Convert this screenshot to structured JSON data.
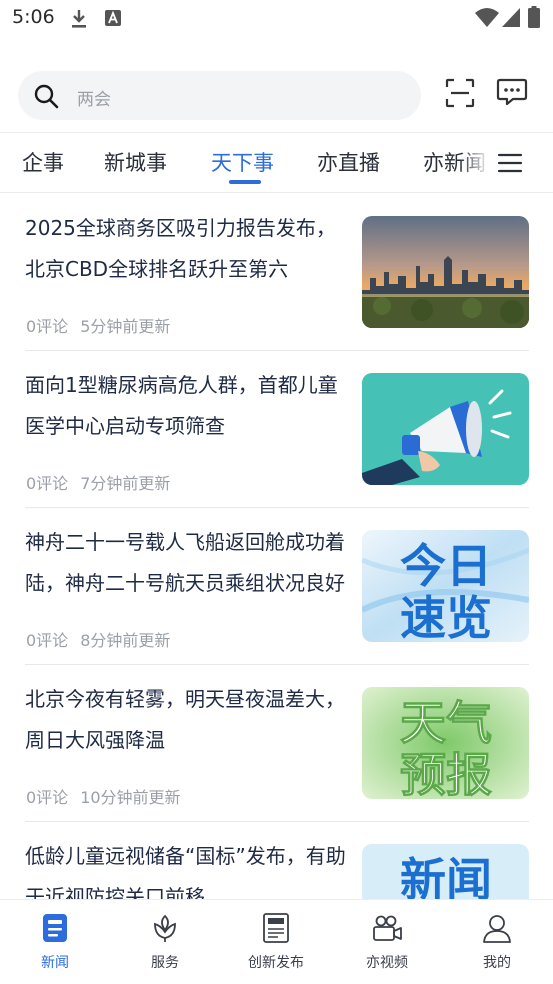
{
  "status_bar": {
    "time": "5:06"
  },
  "search": {
    "placeholder": "两会"
  },
  "tabs": [
    {
      "label": "企事"
    },
    {
      "label": "新城事"
    },
    {
      "label": "天下事",
      "active": true
    },
    {
      "label": "亦直播"
    },
    {
      "label": "亦新闻"
    }
  ],
  "feed": [
    {
      "title": "2025全球商务区吸引力报告发布，北京CBD全球排名跃升至第六",
      "comments": "0评论",
      "time": "5分钟前更新",
      "thumb": "city-skyline"
    },
    {
      "title": "面向1型糖尿病高危人群，首都儿童医学中心启动专项筛查",
      "comments": "0评论",
      "time": "7分钟前更新",
      "thumb": "megaphone"
    },
    {
      "title": "神舟二十一号载人飞船返回舱成功着陆，神舟二十号航天员乘组状况良好",
      "comments": "0评论",
      "time": "8分钟前更新",
      "thumb": "today-overview",
      "thumb_text": "今日速览"
    },
    {
      "title": "北京今夜有轻雾，明天昼夜温差大，周日大风强降温",
      "comments": "0评论",
      "time": "10分钟前更新",
      "thumb": "weather-forecast",
      "thumb_text": "天气预报"
    },
    {
      "title": "低龄儿童远视储备“国标”发布，有助于近视防控关口前移",
      "comments": "",
      "time": "",
      "thumb": "news",
      "thumb_text": "新闻"
    }
  ],
  "bottom_nav": [
    {
      "label": "新闻",
      "icon": "news-icon",
      "active": true
    },
    {
      "label": "服务",
      "icon": "service-icon"
    },
    {
      "label": "创新发布",
      "icon": "publish-icon"
    },
    {
      "label": "亦视频",
      "icon": "video-icon"
    },
    {
      "label": "我的",
      "icon": "profile-icon"
    }
  ],
  "colors": {
    "accent": "#2c6cdc",
    "text": "#1f2a44",
    "meta": "#9ba0a8"
  }
}
